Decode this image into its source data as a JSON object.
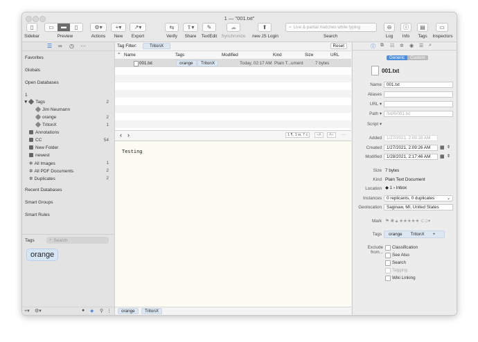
{
  "window": {
    "title": "1 — \"001.txt\""
  },
  "toolbar": {
    "sidebar": "Sidebar",
    "preview": "Preview",
    "actions": "Actions",
    "new": "New",
    "export": "Export",
    "verify": "Verify",
    "share": "Share",
    "textedit": "TextEdit",
    "synchronize": "Synchronize",
    "jslogin": "new JS Login",
    "search_placeholder": "Live & partial matches while typing",
    "search": "Search",
    "log": "Log",
    "info": "Info",
    "tags": "Tags",
    "inspectors": "Inspectors"
  },
  "sidebar": {
    "sections": {
      "favorites": "Favorites",
      "globals": "Globals",
      "open_databases": "Open Databases",
      "recent_databases": "Recent Databases",
      "smart_groups": "Smart Groups",
      "smart_rules": "Smart Rules"
    },
    "database": "1",
    "tags_group": {
      "label": "Tags",
      "count": "2"
    },
    "tag_items": [
      {
        "label": "Jim Neumann",
        "count": ""
      },
      {
        "label": "orange",
        "count": "2"
      },
      {
        "label": "TritonX",
        "count": "1"
      }
    ],
    "groups": [
      {
        "label": "Annotations",
        "count": "",
        "icon": "folder-icon"
      },
      {
        "label": "CC",
        "count": "54",
        "icon": "folder-icon"
      },
      {
        "label": "New Folder",
        "count": "",
        "icon": "folder-icon"
      },
      {
        "label": "newest",
        "count": "",
        "icon": "folder-icon"
      },
      {
        "label": "All Images",
        "count": "1",
        "icon": "gear-icon"
      },
      {
        "label": "All PDF Documents",
        "count": "2",
        "icon": "gear-icon"
      },
      {
        "label": "Duplicates",
        "count": "2",
        "icon": "gear-icon"
      }
    ],
    "tags_panel": {
      "label": "Tags",
      "search_placeholder": "Search",
      "big_tag": "orange"
    }
  },
  "center": {
    "tag_filter_label": "Tag Filter:",
    "tag_filter_value": "TritonX",
    "reset": "Reset",
    "columns": [
      "Name",
      "Tags",
      "Modified",
      "Kind",
      "Size",
      "URL"
    ],
    "row": {
      "name": "001.txt",
      "tag1": "orange",
      "tag2": "TritonX",
      "modified": "Today, 02:17 AM",
      "kind": "Plain T...ument",
      "size": "7 bytes"
    },
    "nav_info": "1 ¶, 1 w, 7 c",
    "preview_text": "Testing",
    "bottom_tags": [
      "orange",
      "TritonX"
    ]
  },
  "inspector": {
    "segment": [
      "Generic",
      "Custom"
    ],
    "file_name": "001.txt",
    "labels": {
      "name": "Name",
      "aliases": "Aliases",
      "url": "URL",
      "path": "Path",
      "script": "Script",
      "added": "Added",
      "created": "Created",
      "modified": "Modified",
      "size": "Size",
      "kind": "Kind",
      "location": "Location",
      "instances": "Instances",
      "geolocation": "Geolocation",
      "mark": "Mark",
      "tags": "Tags",
      "exclude": "Exclude from..."
    },
    "values": {
      "name": "001.txt",
      "path": "/txt/6/001.txt",
      "added": "1/27/2021,   2:09:28 AM",
      "created": "1/27/2021,   2:09:26 AM",
      "modified": "1/28/2021,   2:17:46 AM",
      "size": "7 bytes",
      "kind": "Plain Text Document",
      "location": "1  ›  Inbox",
      "instances": "0 replicants, 0 duplicates",
      "geolocation": "Saginaw, MI, United States"
    },
    "tags": [
      "orange",
      "TritonX",
      "+"
    ],
    "exclude": [
      "Classification",
      "See Also",
      "Search",
      "Tagging",
      "Wiki Linking"
    ]
  }
}
